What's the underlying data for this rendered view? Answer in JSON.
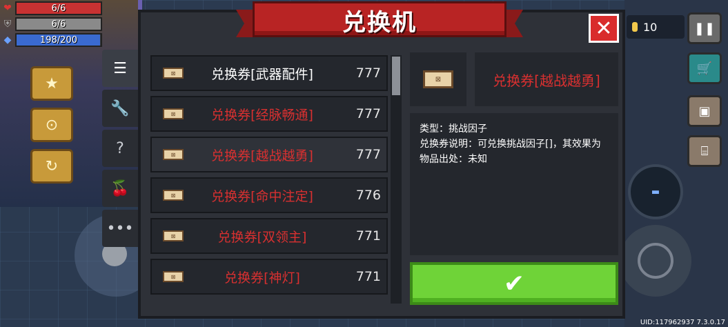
{
  "title": "兑换机",
  "hud": {
    "hp": {
      "text": "6/6",
      "color": "#c83232"
    },
    "armor": {
      "text": "6/6",
      "color": "#8a8a8a"
    },
    "energy": {
      "text": "198/200",
      "color": "#3a6ad0"
    }
  },
  "coins": "10",
  "tabs": [
    {
      "icon": "list-icon",
      "glyph": "☰"
    },
    {
      "icon": "wrench-icon",
      "glyph": "🔧"
    },
    {
      "icon": "question-icon",
      "glyph": "?"
    },
    {
      "icon": "cherry-icon",
      "glyph": "🍒"
    },
    {
      "icon": "more-icon",
      "glyph": "•••"
    }
  ],
  "items": [
    {
      "name": "兑换券[武器配件]",
      "count": "777",
      "color": "#ffffff"
    },
    {
      "name": "兑换券[经脉畅通]",
      "count": "777",
      "color": "#d93030"
    },
    {
      "name": "兑换券[越战越勇]",
      "count": "777",
      "color": "#d93030"
    },
    {
      "name": "兑换券[命中注定]",
      "count": "776",
      "color": "#d93030"
    },
    {
      "name": "兑换券[双领主]",
      "count": "771",
      "color": "#d93030"
    },
    {
      "name": "兑换券[神灯]",
      "count": "771",
      "color": "#d93030"
    }
  ],
  "detail": {
    "name": "兑换券[越战越勇]",
    "type_line": "类型：挑战因子",
    "desc_line": "兑换券说明：可兑换挑战因子[]，其效果为",
    "source_line": "物品出处：未知"
  },
  "uid": "UID:117962937 7.3.0.17"
}
